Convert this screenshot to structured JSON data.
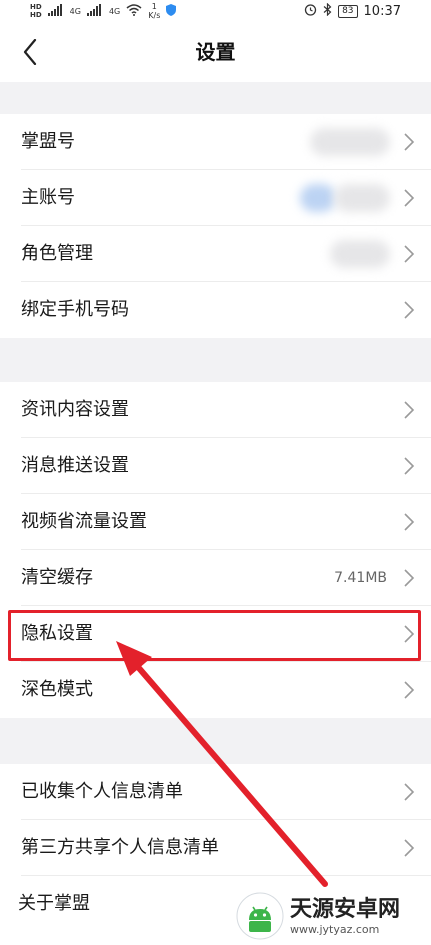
{
  "status_bar": {
    "hd_top": "HD",
    "hd_bottom": "HD",
    "signal1": "4G",
    "signal2": "4G",
    "speed_value": "1",
    "speed_unit": "K/s",
    "battery": "83",
    "time": "10:37"
  },
  "header": {
    "title": "设置"
  },
  "groups": [
    {
      "rows": [
        {
          "label": "掌盟号",
          "value": "",
          "blurred": "gray"
        },
        {
          "label": "主账号",
          "value": "",
          "blurred": "blue"
        },
        {
          "label": "角色管理",
          "value": "",
          "blurred": "gray"
        },
        {
          "label": "绑定手机号码",
          "value": "",
          "blurred": ""
        }
      ]
    },
    {
      "rows": [
        {
          "label": "资讯内容设置",
          "value": ""
        },
        {
          "label": "消息推送设置",
          "value": ""
        },
        {
          "label": "视频省流量设置",
          "value": ""
        },
        {
          "label": "清空缓存",
          "value": "7.41MB"
        },
        {
          "label": "隐私设置",
          "value": "",
          "highlighted": true
        },
        {
          "label": "深色模式",
          "value": ""
        }
      ]
    },
    {
      "rows": [
        {
          "label": "已收集个人信息清单",
          "value": ""
        },
        {
          "label": "第三方共享个人信息清单",
          "value": ""
        },
        {
          "label": "关于掌盟",
          "value": ""
        }
      ]
    }
  ],
  "annotation": {
    "color": "#e3212b"
  },
  "watermark": {
    "title": "天源安卓网",
    "url": "www.jytyaz.com"
  }
}
